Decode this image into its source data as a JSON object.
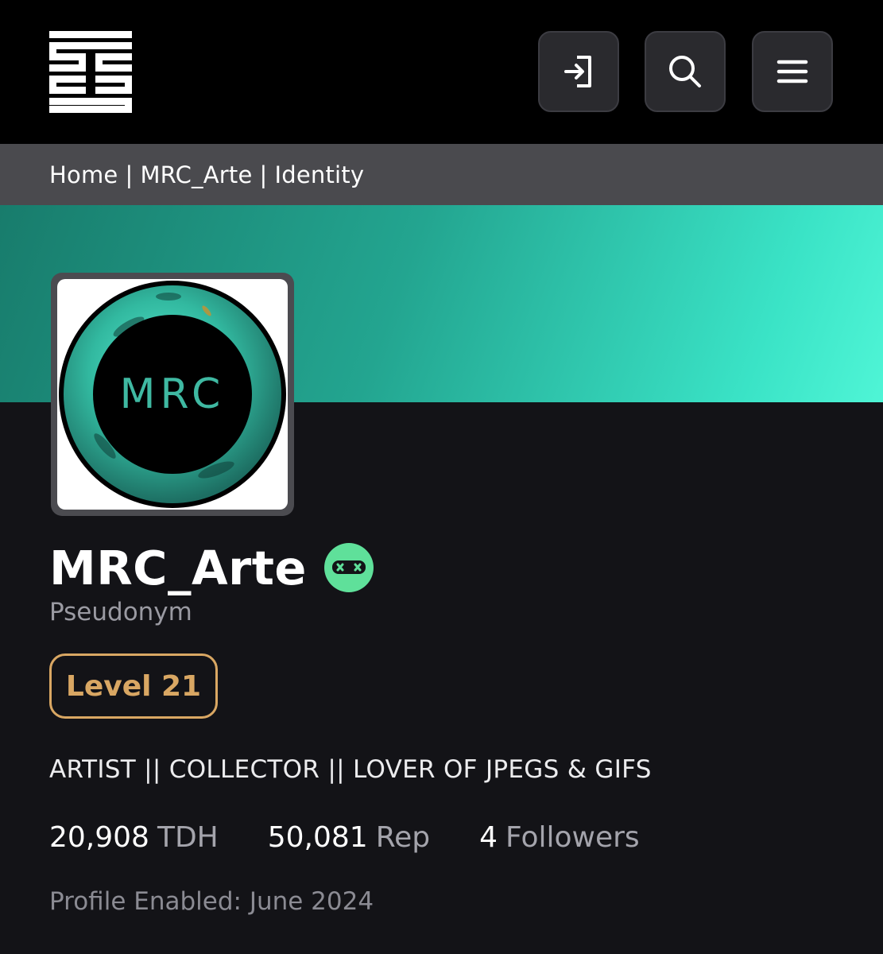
{
  "header": {
    "logo_icon": "stacked-lines-logo",
    "buttons": [
      {
        "icon": "sign-in-icon"
      },
      {
        "icon": "search-icon"
      },
      {
        "icon": "menu-icon"
      }
    ]
  },
  "breadcrumb": {
    "items": [
      "Home",
      "MRC_Arte",
      "Identity"
    ],
    "separator": "|"
  },
  "banner": {
    "gradient_start": "#187c6c",
    "gradient_end": "#4ff5d6"
  },
  "profile": {
    "avatar_text": "MRC",
    "name": "MRC_Arte",
    "badge_icon": "pseudonym-mask-icon",
    "classification": "Pseudonym",
    "level": "Level 21",
    "bio": "ARTIST || COLLECTOR || LOVER OF JPEGS & GIFS",
    "stats": [
      {
        "value": "20,908",
        "label": "TDH"
      },
      {
        "value": "50,081",
        "label": "Rep"
      },
      {
        "value": "4",
        "label": "Followers"
      }
    ],
    "enabled": "Profile Enabled: June 2024"
  },
  "colors": {
    "accent_teal": "#3ae3c6",
    "level_gold": "#d9a763",
    "badge_green": "#5fe09a"
  }
}
